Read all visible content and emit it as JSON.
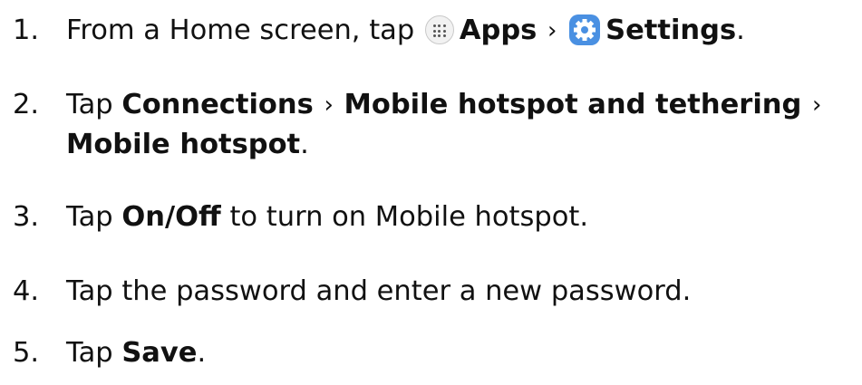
{
  "steps": [
    {
      "number": "1.",
      "text_before": "From a Home screen, tap",
      "apps_label": "Apps",
      "separator": "›",
      "settings_label": "Settings",
      "text_after": ".",
      "icons": [
        "apps-grid-icon",
        "settings-gear-icon"
      ]
    },
    {
      "number": "2.",
      "text_before": "Tap",
      "connections_label": "Connections",
      "separator": "›",
      "hotspot_tethering_label": "Mobile hotspot and tethering",
      "mobile_hotspot_label": "Mobile hotspot",
      "text_after": "."
    },
    {
      "number": "3.",
      "text_before": "Tap",
      "onoff_label": "On/Off",
      "text_after": "to turn on Mobile hotspot."
    },
    {
      "number": "4.",
      "text": "Tap the password and enter a new password."
    },
    {
      "number": "5.",
      "text_before": "Tap",
      "save_label": "Save",
      "text_after": "."
    }
  ]
}
